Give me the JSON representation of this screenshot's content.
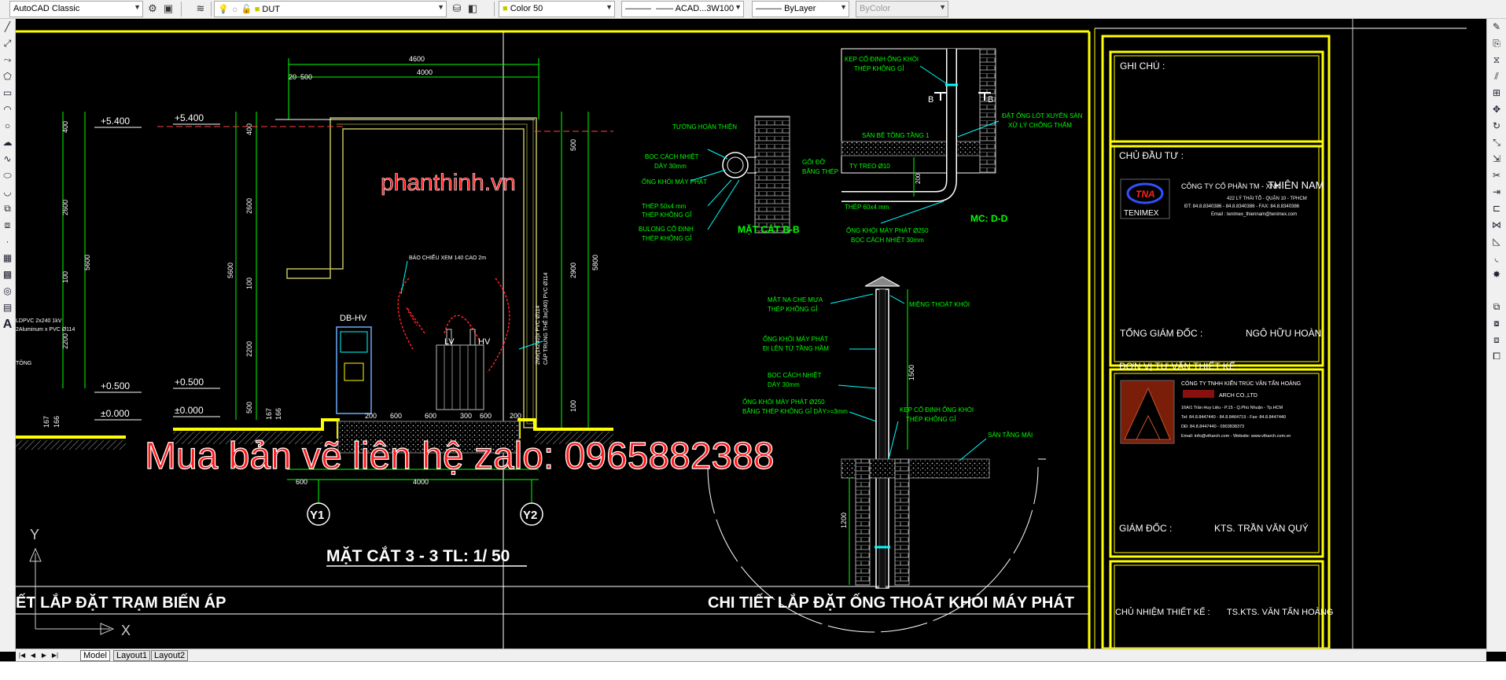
{
  "toolbar": {
    "workspace": "AutoCAD Classic",
    "layer": "DUT",
    "color": "Color 50",
    "linetype": "ACAD...3W100",
    "lineweight": "ByLayer",
    "plotstyle": "ByColor"
  },
  "left_tools": [
    "line",
    "polyline",
    "polygon",
    "rectangle",
    "arc",
    "circle",
    "revcloud",
    "spline",
    "ellipse",
    "ellipse-arc",
    "insert",
    "make-block",
    "point",
    "hatch",
    "gradient",
    "region",
    "table",
    "multiline-text"
  ],
  "right_tools": [
    "erase",
    "copy",
    "mirror",
    "offset",
    "array",
    "move",
    "rotate",
    "scale",
    "stretch",
    "trim",
    "extend",
    "break",
    "join",
    "chamfer",
    "fillet",
    "explode"
  ],
  "layout_tabs": [
    "Model",
    "Layout1",
    "Layout2"
  ],
  "drawing": {
    "watermark_site": "phanthinh.vn",
    "watermark_contact": "Mua bản vẽ liên hệ zalo: 0965882388",
    "section_title": "MẶT CẮT 3 - 3 TL: 1/ 50",
    "left_footer_title": "ẾT LẮP ĐẶT TRẠM BIẾN ÁP",
    "right_footer_title": "CHI TIẾT LẮP ĐẶT ỐNG THOÁT KHÓI MÁY PHÁT",
    "axis_y1": "Y1",
    "axis_y2": "Y2",
    "ucs_x": "X",
    "ucs_y": "Y",
    "dims": {
      "d4600": "4600",
      "d4000top": "4000",
      "d20": "20",
      "d500top": "500",
      "d400": "400",
      "d2600": "2600",
      "d100": "100",
      "d2200": "2200",
      "d5600": "5600",
      "d167": "167",
      "d166": "166",
      "r400": "400",
      "r2600": "2600",
      "r100": "100",
      "r2200": "2200",
      "r5600": "5600",
      "r500": "500",
      "rr500": "500",
      "rr2900": "2900",
      "rr5800": "5800",
      "rr100": "100",
      "b200": "200",
      "b600a": "600",
      "b600b": "600",
      "b600c": "600",
      "b300": "300",
      "b200b": "200",
      "b600left": "600",
      "b4000": "4000"
    },
    "levels": {
      "l5400a": "+5.400",
      "l5400b": "+5.400",
      "l0500a": "+0.500",
      "l0500b": "+0.500",
      "l0000a": "±0.000",
      "l0000b": "±0.000"
    },
    "equipment": {
      "db_hv": "DB-HV",
      "lv": "LV",
      "hv": "HV",
      "note_cable": "BÁO CHIẾU XEM 140 CAO 2m",
      "note_left1": "LDPVC 2x240 1kV",
      "note_left2": "2Aluminum x PVC Ø114",
      "note_left3": "TÔNG",
      "note_vertical1": "CÁP TRUNG THẾ 3x(240) PVC Ø114",
      "note_vertical2": "2Mx(1x240)x PVC Ø114"
    },
    "detail_bb": {
      "title": "MẶT CẮT B-B",
      "n1": "TƯỜNG HOÀN THIỆN",
      "n2": "BỌC CÁCH NHIỆT",
      "n2b": "DÀY 30mm",
      "n3": "ỐNG KHÓI MÁY PHÁT",
      "n4": "THÉP 50x4 mm",
      "n4b": "THÉP KHÔNG GỈ",
      "n5": "BULONG CỐ ĐỊNH",
      "n5b": "THÉP KHÔNG GỈ",
      "n6": "GỐI ĐỠ",
      "n6b": "BẰNG THÉP"
    },
    "detail_dd": {
      "title": "MC: D-D",
      "n1": "KẸP CỐ ĐỊNH ỐNG KHÓI",
      "n1b": "THÉP KHÔNG GỈ",
      "n2": "ĐẶT ỐNG LÓT XUYÊN SÀN",
      "n2b": "XỬ LÝ CHỐNG THẤM",
      "n3": "SÀN BÊ TÔNG TẦNG 1",
      "n4": "TY TREO Ø10",
      "n5": "THÉP 60x4 mm",
      "n6": "ỐNG KHÓI MÁY PHÁT Ø250",
      "n6b": "BỌC CÁCH NHIỆT 30mm",
      "dim200": "200",
      "b1": "B",
      "b2": "B"
    },
    "detail_roof": {
      "n1": "MẶT NẠ CHE MƯA",
      "n1b": "THÉP KHÔNG GỈ",
      "n2": "MIỆNG THOÁT KHÓI",
      "n3": "ỐNG KHÓI MÁY PHÁT",
      "n3b": "ĐI LÊN TỪ TẦNG HẦM",
      "n4": "BỌC CÁCH NHIỆT",
      "n4b": "DÀY 30mm",
      "n5": "ỐNG KHÓI MÁY PHÁT Ø250",
      "n5b": "BẰNG THÉP KHÔNG GỈ DÀY>=3mm",
      "n6": "KẸP CỐ ĐỊNH ỐNG KHÓI",
      "n6b": "THÉP KHÔNG GỈ",
      "n7": "SÀN TẦNG MÁI",
      "dim1500": "1500",
      "dim1200": "1200"
    }
  },
  "title_block": {
    "notes_label": "GHI CHÚ :",
    "owner_label": "CHỦ ĐẦU TƯ :",
    "owner_company_prefix": "CÔNG TY CỔ PHẦN TM - XNK",
    "owner_company_name": "THIÊN NAM",
    "owner_address": "422 LÝ THÁI TỔ - QUẬN 10 - TPHCM",
    "owner_phone": "ĐT: 84.8.8340386 - 84.8.8340386 - FAX: 84.8.8340386",
    "owner_email": "Email : tenimex_thiennam@tenimex.com",
    "owner_logo_short": "TNA",
    "owner_logo_text": "TENIMEX",
    "owner_director_label": "TỔNG GIÁM ĐỐC :",
    "owner_director_name": "NGÔ HỮU HOÀN",
    "consultant_label": "ĐƠN VỊ TƯ VẤN THIẾT KẾ :",
    "consultant_company": "CÔNG TY TNHH KIẾN TRÚC VĂN TẤN HOÀNG",
    "consultant_sub": "ARCH CO.,LTD",
    "consultant_addr1": "16A/1 Trần Huy Liệu - P.15 - Q.Phú Nhuận - Tp.HCM",
    "consultant_addr2": "Tel: 84.8.8447440 - 84.8.8464719 - Fax: 84.8.8447440",
    "consultant_addr3": "DĐ: 84.8.8447440 - 0903838373",
    "consultant_addr4": "Email: info@vtharch.com - Website: www.vtharch.com.vn",
    "consultant_director_label": "GIÁM ĐỐC :",
    "consultant_director_name": "KTS. TRẦN VĂN QUÝ",
    "design_lead_label": "CHỦ NHIỆM THIẾT KẾ :",
    "design_lead_name": "TS.KTS. VĂN TẤN HOÀNG"
  },
  "colors": {
    "frame_yellow": "#ffff00",
    "dim_green": "#00ff00",
    "wall_outline": "#c0c060",
    "watermark_red": "#ff1a1a",
    "cyan": "#00ffff"
  }
}
